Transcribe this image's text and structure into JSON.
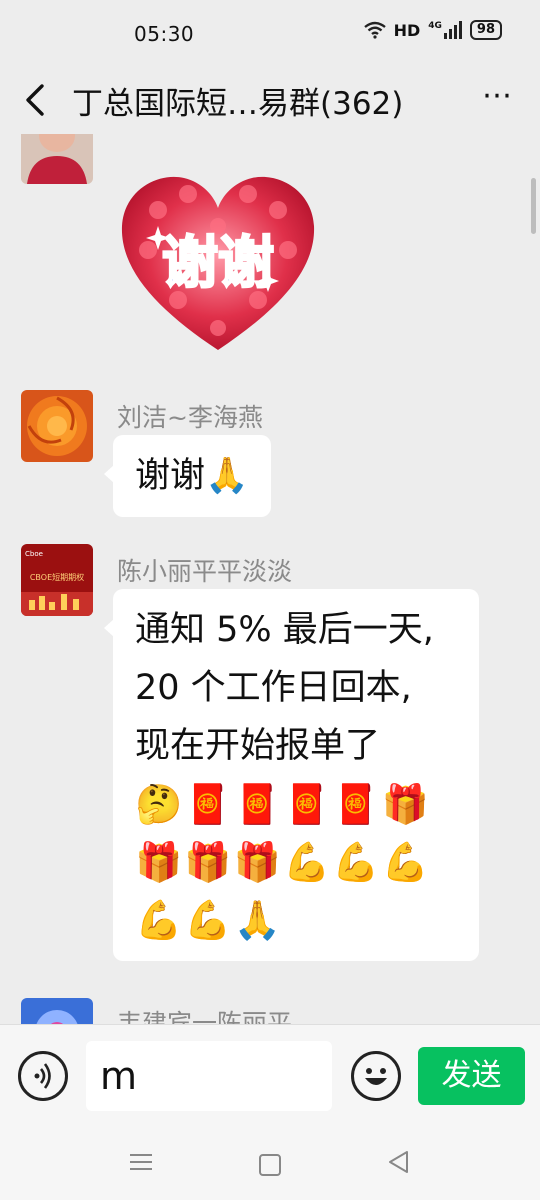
{
  "status_bar": {
    "time": "05:30",
    "network": "HD",
    "signal": "4G",
    "battery": "98"
  },
  "header": {
    "title": "丁总国际短…易群(362)",
    "back_icon": "chevron-left-icon",
    "more_icon": "more-dots-icon"
  },
  "messages": [
    {
      "sender": "",
      "type": "sticker",
      "sticker_text": "谢谢"
    },
    {
      "sender": "刘洁~李海燕",
      "type": "text",
      "text": "谢谢🙏"
    },
    {
      "sender": "陈小丽平平淡淡",
      "type": "text",
      "lines": [
        "通知 5% 最后一天,",
        "20 个工作日回本,",
        "现在开始报单了"
      ],
      "emoji_lines": [
        "🤔🧧🧧🧧🧧🎁",
        "🎁🎁🎁💪💪💪",
        "💪💪🙏"
      ]
    },
    {
      "sender": "韦建宾一陈丽平",
      "type": "text"
    }
  ],
  "input_bar": {
    "value": "m",
    "send_label": "发送",
    "voice_icon": "voice-icon",
    "emoji_icon": "emoji-icon"
  },
  "avatar_card": {
    "brand": "Cboe",
    "title": "CBOE短期期权"
  },
  "colors": {
    "send": "#07c160",
    "bg": "#ededed"
  }
}
